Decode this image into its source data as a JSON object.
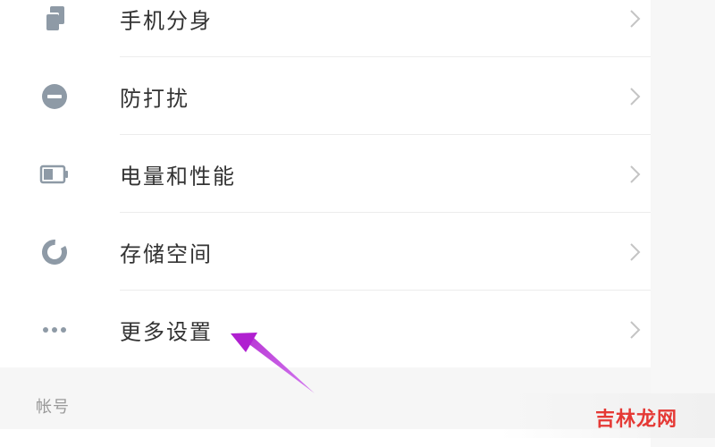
{
  "settings": {
    "items": [
      {
        "label": "手机分身",
        "icon": "phone-clone-icon"
      },
      {
        "label": "防打扰",
        "icon": "do-not-disturb-icon"
      },
      {
        "label": "电量和性能",
        "icon": "battery-icon"
      },
      {
        "label": "存储空间",
        "icon": "storage-icon"
      },
      {
        "label": "更多设置",
        "icon": "more-dots-icon"
      }
    ],
    "section_label": "帐号"
  },
  "annotation": {
    "arrow_color": "#c040e0"
  },
  "watermark": {
    "text": "吉林龙网"
  },
  "colors": {
    "icon": "#8e9aa6",
    "chevron": "#c4c4c4",
    "text": "#333333"
  }
}
